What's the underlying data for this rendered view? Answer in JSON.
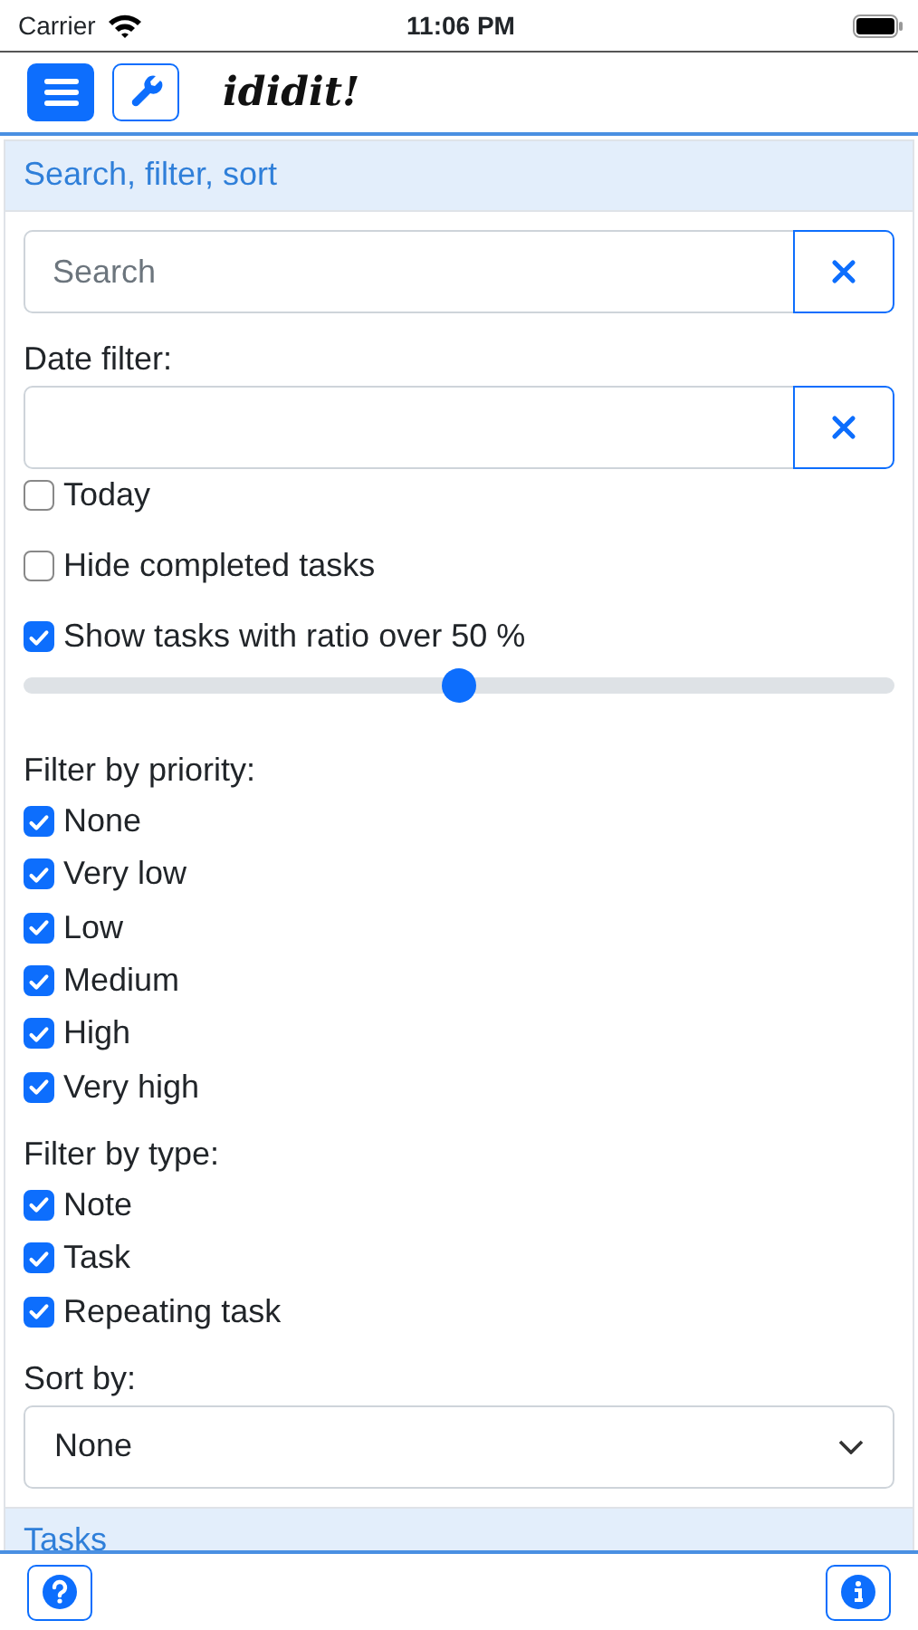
{
  "status_bar": {
    "carrier": "Carrier",
    "time": "11:06 PM"
  },
  "app_bar": {
    "title": "ididit!"
  },
  "panel": {
    "title": "Search, filter, sort",
    "search": {
      "placeholder": "Search"
    },
    "date_filter": {
      "label": "Date filter:"
    },
    "options": [
      {
        "label": "Today",
        "checked": false
      },
      {
        "label": "Hide completed tasks",
        "checked": false
      },
      {
        "label": "Show tasks with ratio over 50 %",
        "checked": true
      }
    ],
    "ratio_slider": {
      "level": 0.5
    },
    "priority": {
      "label": "Filter by priority:",
      "items": [
        {
          "label": "None",
          "checked": true
        },
        {
          "label": "Very low",
          "checked": true
        },
        {
          "label": "Low",
          "checked": true
        },
        {
          "label": "Medium",
          "checked": true
        },
        {
          "label": "High",
          "checked": true
        },
        {
          "label": "Very high",
          "checked": true
        }
      ]
    },
    "type": {
      "label": "Filter by type:",
      "items": [
        {
          "label": "Note",
          "checked": true
        },
        {
          "label": "Task",
          "checked": true
        },
        {
          "label": "Repeating task",
          "checked": true
        }
      ]
    },
    "sort": {
      "label": "Sort by:",
      "value": "None"
    }
  },
  "next_panel": {
    "title": "Tasks"
  }
}
